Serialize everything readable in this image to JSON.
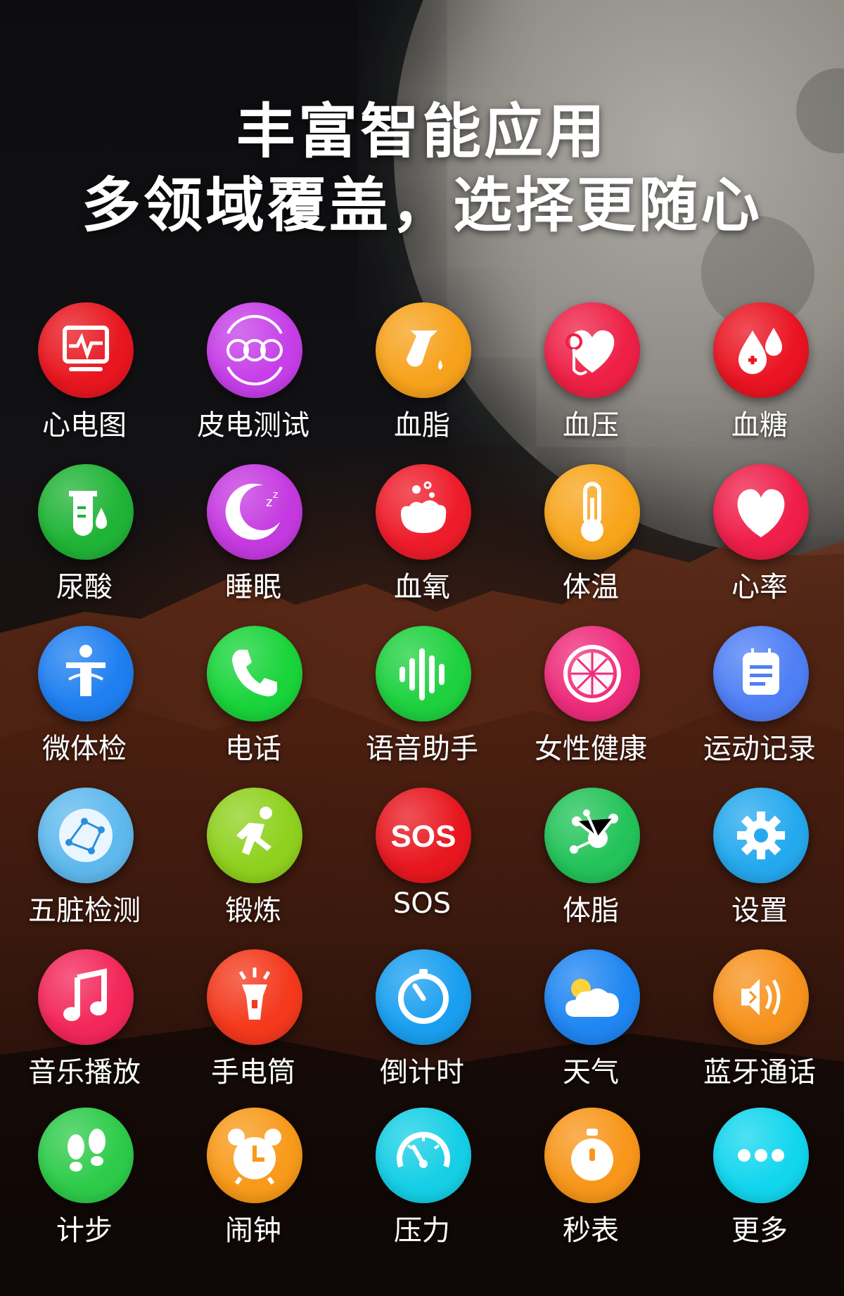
{
  "headline": {
    "line1": "丰富智能应用",
    "line2": "多领域覆盖，选择更随心"
  },
  "apps": [
    {
      "label": "心电图",
      "icon": "ecg-icon",
      "color": "#e8161f"
    },
    {
      "label": "皮电测试",
      "icon": "skin-conductance-icon",
      "color": "#c63fe8"
    },
    {
      "label": "血脂",
      "icon": "blood-lipid-icon",
      "color": "#f7a21c"
    },
    {
      "label": "血压",
      "icon": "blood-pressure-icon",
      "color": "#ee2046"
    },
    {
      "label": "血糖",
      "icon": "blood-sugar-icon",
      "color": "#ea1422"
    },
    {
      "label": "尿酸",
      "icon": "uric-acid-icon",
      "color": "#20b437"
    },
    {
      "label": "睡眠",
      "icon": "sleep-icon",
      "color": "#c53ae0"
    },
    {
      "label": "血氧",
      "icon": "blood-oxygen-icon",
      "color": "#ee1c2a"
    },
    {
      "label": "体温",
      "icon": "thermometer-icon",
      "color": "#f8a51b"
    },
    {
      "label": "心率",
      "icon": "heart-icon",
      "color": "#ef1f4a"
    },
    {
      "label": "微体检",
      "icon": "body-check-icon",
      "color": "#1f7ff0"
    },
    {
      "label": "电话",
      "icon": "phone-icon",
      "color": "#19d43a"
    },
    {
      "label": "语音助手",
      "icon": "voice-assistant-icon",
      "color": "#1ed13f"
    },
    {
      "label": "女性健康",
      "icon": "female-health-icon",
      "color": "#ee2c7c"
    },
    {
      "label": "运动记录",
      "icon": "exercise-record-icon",
      "color": "#4f7ff5"
    },
    {
      "label": "五脏检测",
      "icon": "organ-check-icon",
      "color": "#5fb9ee"
    },
    {
      "label": "锻炼",
      "icon": "running-icon",
      "color": "#8fd11e"
    },
    {
      "label": "SOS",
      "icon": "sos-icon",
      "color": "#e8171f"
    },
    {
      "label": "体脂",
      "icon": "body-fat-icon",
      "color": "#24c35a"
    },
    {
      "label": "设置",
      "icon": "gear-icon",
      "color": "#25a9ee"
    },
    {
      "label": "音乐播放",
      "icon": "music-icon",
      "color": "#f3275a"
    },
    {
      "label": "手电筒",
      "icon": "flashlight-icon",
      "color": "#f4391d"
    },
    {
      "label": "倒计时",
      "icon": "countdown-icon",
      "color": "#1a9ff0"
    },
    {
      "label": "天气",
      "icon": "weather-icon",
      "color": "#1f86f2"
    },
    {
      "label": "蓝牙通话",
      "icon": "bluetooth-call-icon",
      "color": "#f7921d"
    },
    {
      "label": "计步",
      "icon": "footsteps-icon",
      "color": "#2ecb4a"
    },
    {
      "label": "闹钟",
      "icon": "alarm-clock-icon",
      "color": "#f89a1a"
    },
    {
      "label": "压力",
      "icon": "stress-gauge-icon",
      "color": "#16cfe6"
    },
    {
      "label": "秒表",
      "icon": "stopwatch-icon",
      "color": "#f8961a"
    },
    {
      "label": "更多",
      "icon": "more-icon",
      "color": "#12d6ee"
    }
  ]
}
